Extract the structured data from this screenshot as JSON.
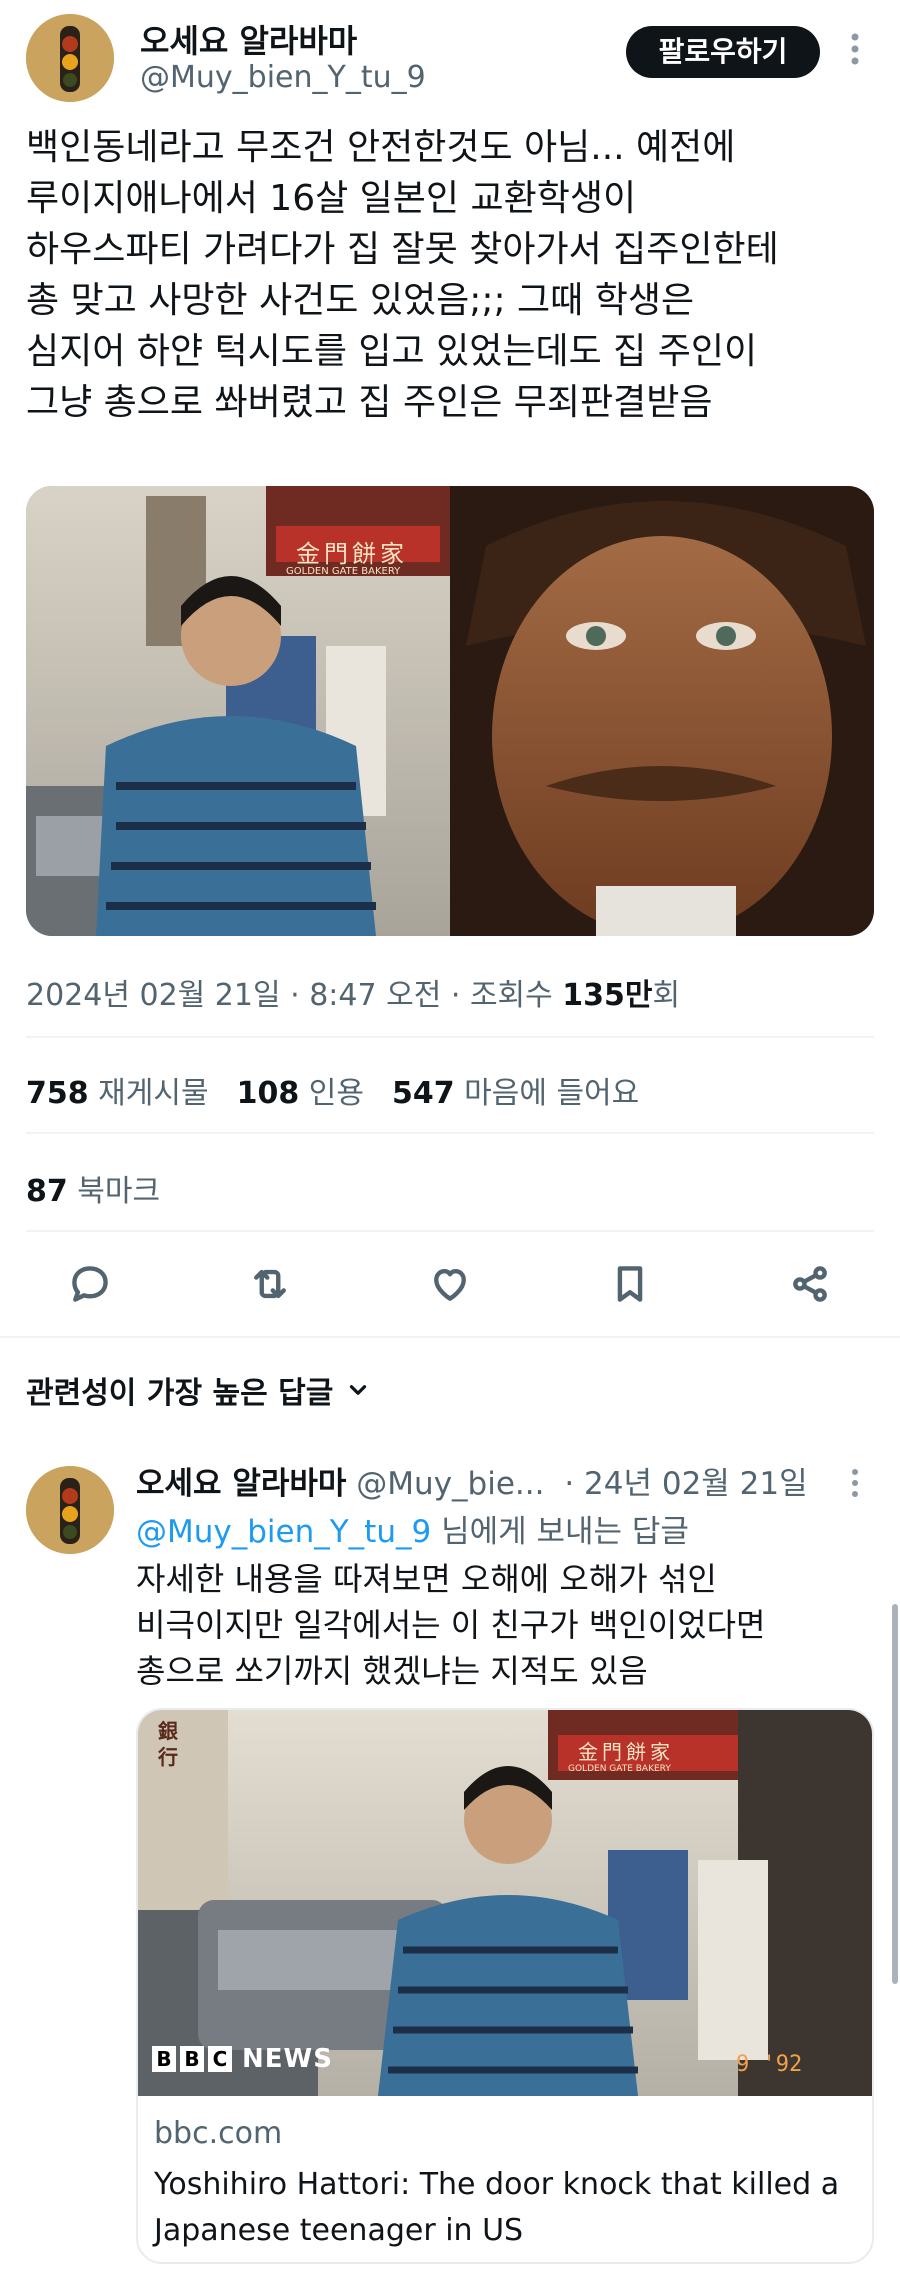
{
  "tweet": {
    "author_name": "오세요 알라바마",
    "author_handle": "@Muy_bien_Y_tu_9",
    "follow_label": "팔로우하기",
    "more_icon": "more-vertical-icon",
    "text": "백인동네라고 무조건 안전한것도 아님... 예전에\n루이지애나에서 16살 일본인 교환학생이\n하우스파티 가려다가 집 잘못 찾아가서 집주인한테\n총 맞고 사망한 사건도 있었음;;; 그때 학생은\n심지어 하얀 턱시도를 입고 있었는데도 집 주인이\n그냥 총으로 쏴버렸고 집 주인은 무죄판결받음",
    "left_image": {
      "sign_text": "金門餅家",
      "sign_sub": "GOLDEN GATE BAKERY"
    },
    "date": "2024년 02월 21일",
    "time": "8:47 오전",
    "views_label": "조회수",
    "views_count": "135만",
    "views_suffix": "회",
    "stats": [
      {
        "count": "758",
        "label": "재게시물"
      },
      {
        "count": "108",
        "label": "인용"
      },
      {
        "count": "547",
        "label": "마음에 들어요"
      }
    ],
    "bookmarks": {
      "count": "87",
      "label": "북마크"
    },
    "actions": [
      "reply-icon",
      "retweet-icon",
      "like-icon",
      "bookmark-icon",
      "share-icon"
    ]
  },
  "replies_section": {
    "sort_label": "관련성이 가장 높은 답글",
    "sort_icon": "chevron-down-icon"
  },
  "reply": {
    "author_name": "오세요 알라바마",
    "author_handle": "@Muy_bie...",
    "date": "· 24년 02월 21일",
    "reply_to_handle": "@Muy_bien_Y_tu_9",
    "reply_to_suffix": "님에게 보내는 답글",
    "text": "자세한 내용을 따져보면 오해에 오해가 섞인\n비극이지만 일각에서는 이 친구가 백인이었다면\n총으로 쏘기까지 했겠냐는 지적도 있음",
    "card": {
      "sign_text": "金門餅家",
      "sign_sub": "GOLDEN GATE BAKERY",
      "side_sign": "銀行",
      "bbc_letters": [
        "B",
        "B",
        "C"
      ],
      "bbc_news": "NEWS",
      "photo_date": "9 '92",
      "domain": "bbc.com",
      "title": "Yoshihiro Hattori: The door knock that killed a Japanese teenager in US"
    }
  },
  "colors": {
    "accent": "#1d9bf0",
    "text": "#0f1419",
    "muted": "#536471",
    "divider": "#eff3f4"
  }
}
